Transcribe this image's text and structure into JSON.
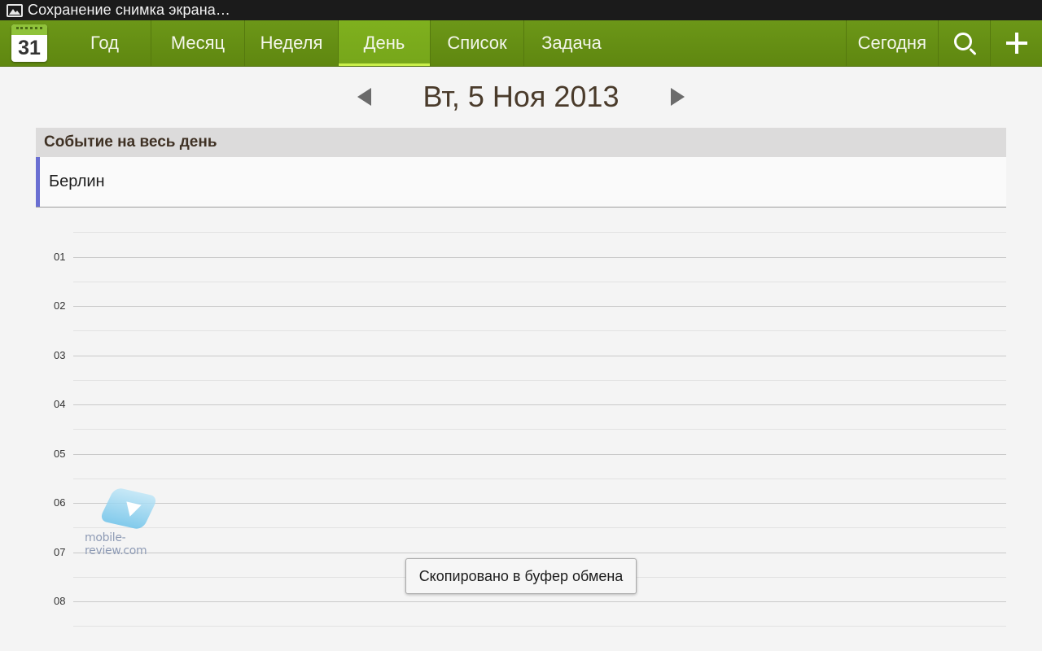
{
  "status_bar": {
    "notification_icon": "image-icon",
    "text": "Сохранение снимка экрана…"
  },
  "action_bar": {
    "app_icon": {
      "name": "calendar-icon",
      "day": "31"
    },
    "tabs": [
      {
        "label": "Год",
        "active": false
      },
      {
        "label": "Месяц",
        "active": false
      },
      {
        "label": "Неделя",
        "active": false
      },
      {
        "label": "День",
        "active": true
      },
      {
        "label": "Список",
        "active": false
      },
      {
        "label": "Задача",
        "active": false
      }
    ],
    "today_label": "Сегодня",
    "search_icon": "search-icon",
    "add_icon": "plus-icon",
    "colors": {
      "bar": "#6c9718",
      "active_tab": "#7fb01e",
      "active_indicator": "#c9ef4a"
    }
  },
  "date_nav": {
    "prev_icon": "triangle-left-icon",
    "title": "Вт,  5 Ноя 2013",
    "next_icon": "triangle-right-icon"
  },
  "all_day": {
    "header": "Событие на весь день",
    "events": [
      {
        "label": "Берлин",
        "color": "#6a6fd2"
      }
    ]
  },
  "day_grid": {
    "hours": [
      "01",
      "02",
      "03",
      "04",
      "05",
      "06",
      "07",
      "08"
    ]
  },
  "watermark": {
    "text": "mobile-review.com"
  },
  "toast": {
    "text": "Скопировано в буфер обмена"
  }
}
